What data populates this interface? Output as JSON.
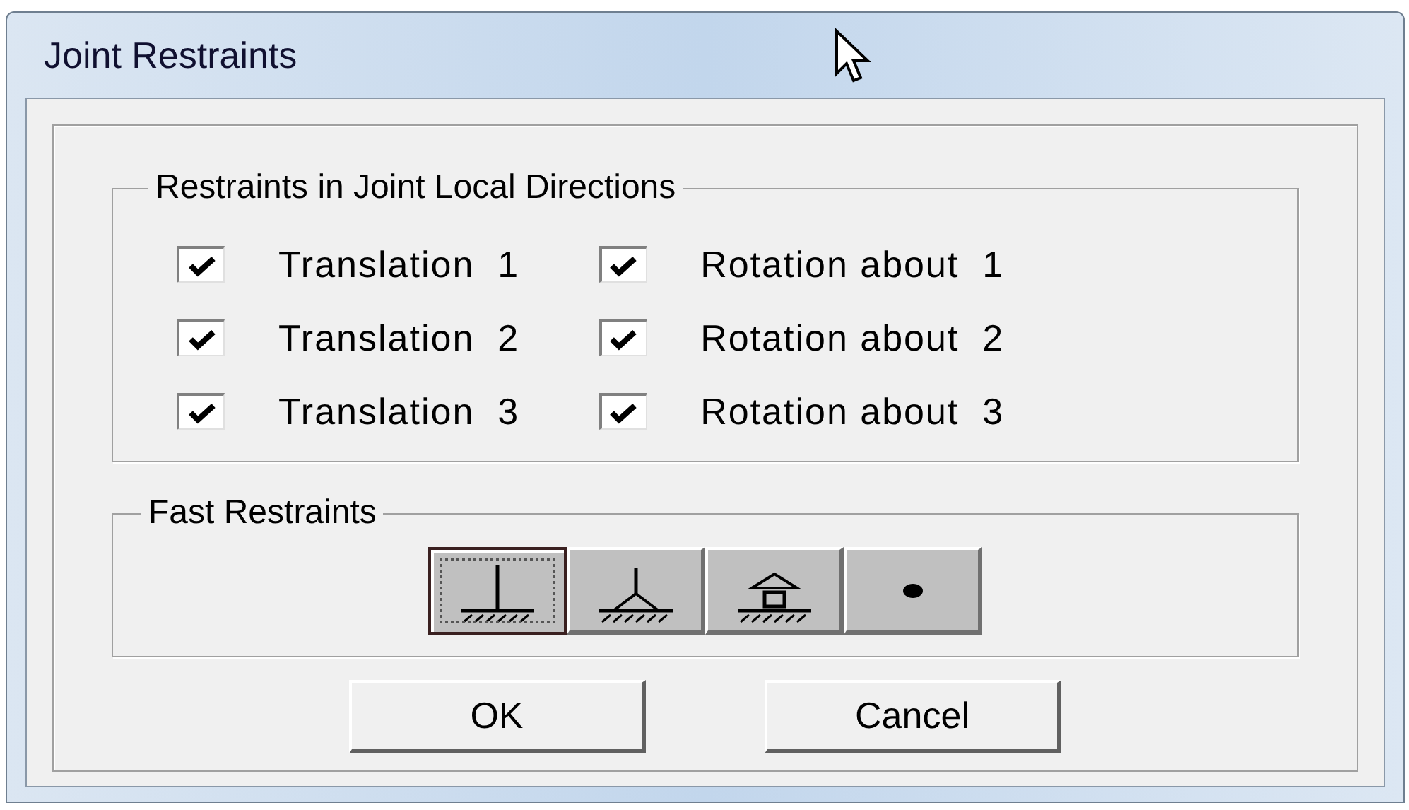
{
  "window": {
    "title": "Joint Restraints"
  },
  "local_directions": {
    "title": "Restraints in Joint Local Directions",
    "columns": [
      [
        {
          "label": "Translation  1",
          "checked": true
        },
        {
          "label": "Translation  2",
          "checked": true
        },
        {
          "label": "Translation  3",
          "checked": true
        }
      ],
      [
        {
          "label": "Rotation about  1",
          "checked": true
        },
        {
          "label": "Rotation about  2",
          "checked": true
        },
        {
          "label": "Rotation about  3",
          "checked": true
        }
      ]
    ]
  },
  "fast_restraints": {
    "title": "Fast Restraints",
    "buttons": [
      {
        "kind": "fixed",
        "selected": true
      },
      {
        "kind": "pinned",
        "selected": false
      },
      {
        "kind": "roller",
        "selected": false
      },
      {
        "kind": "free",
        "selected": false
      }
    ]
  },
  "buttons": [
    "OK",
    "Cancel"
  ]
}
